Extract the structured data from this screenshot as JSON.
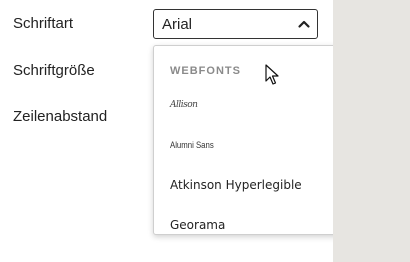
{
  "form": {
    "font_label": "Schriftart",
    "size_label": "Schriftgröße",
    "line_spacing_label": "Zeilenabstand"
  },
  "select": {
    "value": "Arial",
    "chevron_icon": "chevron-up-icon"
  },
  "dropdown": {
    "group_header": "WEBFONTS",
    "options": [
      "Allison",
      "Alumni Sans",
      "Atkinson Hyperlegible",
      "Georama"
    ]
  },
  "colors": {
    "side_strip": "#e7e5e1",
    "scroll_thumb": "#8c8c8c"
  },
  "cursor": {
    "icon": "mouse-pointer-icon"
  }
}
